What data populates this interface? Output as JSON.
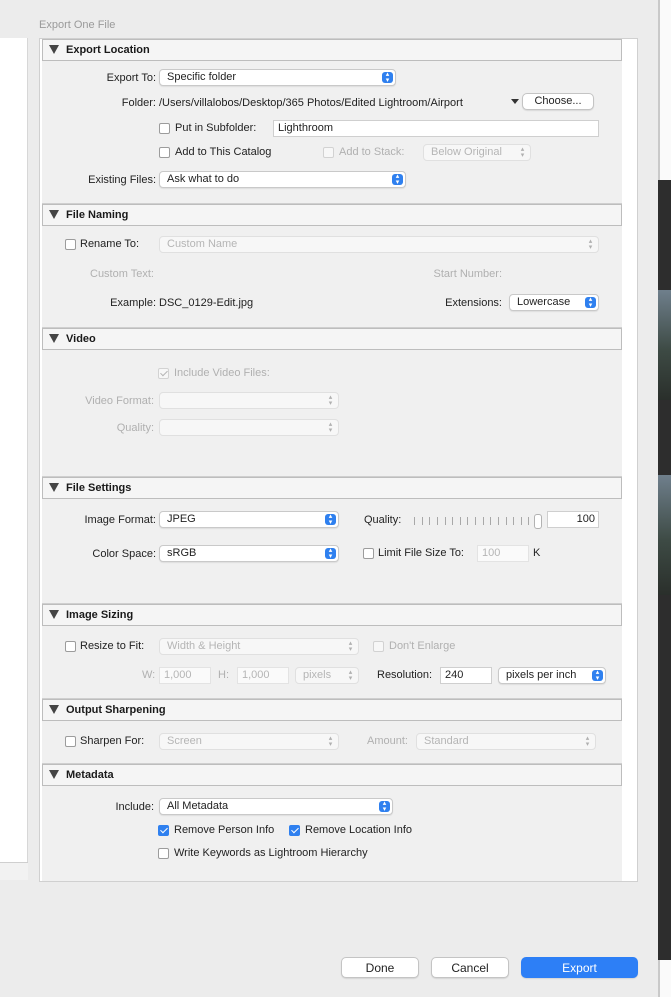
{
  "dialog": {
    "title": "Export One File"
  },
  "export_location": {
    "header": "Export Location",
    "export_to_label": "Export To:",
    "export_to_value": "Specific folder",
    "folder_label": "Folder:",
    "folder_path": "/Users/villalobos/Desktop/365 Photos/Edited Lightroom/Airport",
    "choose_label": "Choose...",
    "subfolder_label": "Put in Subfolder:",
    "subfolder_value": "Lighthroom",
    "add_catalog_label": "Add to This Catalog",
    "add_stack_label": "Add to Stack:",
    "stack_value": "Below Original",
    "existing_label": "Existing Files:",
    "existing_value": "Ask what to do"
  },
  "file_naming": {
    "header": "File Naming",
    "rename_label": "Rename To:",
    "rename_value": "Custom Name",
    "custom_text_label": "Custom Text:",
    "start_number_label": "Start Number:",
    "example_label": "Example:",
    "example_value": "DSC_0129-Edit.jpg",
    "extensions_label": "Extensions:",
    "extensions_value": "Lowercase"
  },
  "video": {
    "header": "Video",
    "include_label": "Include Video Files:",
    "format_label": "Video Format:",
    "quality_label": "Quality:"
  },
  "file_settings": {
    "header": "File Settings",
    "format_label": "Image Format:",
    "format_value": "JPEG",
    "quality_label": "Quality:",
    "quality_value": "100",
    "quality_fraction": 1.0,
    "color_label": "Color Space:",
    "color_value": "sRGB",
    "limit_label": "Limit File Size To:",
    "limit_value": "100",
    "limit_unit": "K"
  },
  "image_sizing": {
    "header": "Image Sizing",
    "resize_label": "Resize to Fit:",
    "resize_value": "Width & Height",
    "enlarge_label": "Don't Enlarge",
    "w_label": "W:",
    "w_value": "1,000",
    "h_label": "H:",
    "h_value": "1,000",
    "units_value": "pixels",
    "resolution_label": "Resolution:",
    "resolution_value": "240",
    "res_units_value": "pixels per inch"
  },
  "output_sharpening": {
    "header": "Output Sharpening",
    "sharpen_label": "Sharpen For:",
    "sharpen_value": "Screen",
    "amount_label": "Amount:",
    "amount_value": "Standard"
  },
  "metadata": {
    "header": "Metadata",
    "include_label": "Include:",
    "include_value": "All Metadata",
    "remove_person_label": "Remove Person Info",
    "remove_location_label": "Remove Location Info",
    "keywords_label": "Write Keywords as Lightroom Hierarchy"
  },
  "buttons": {
    "done": "Done",
    "cancel": "Cancel",
    "export": "Export"
  },
  "colors": {
    "accent": "#2f80ef",
    "primary_button": "#2d7ff6"
  }
}
